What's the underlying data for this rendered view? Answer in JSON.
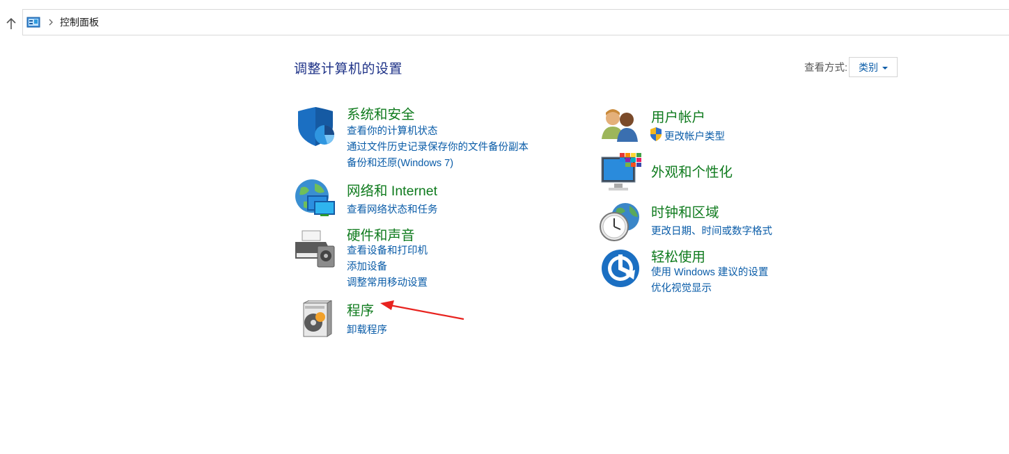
{
  "breadcrumb": {
    "current": "控制面板"
  },
  "main": {
    "heading": "调整计算机的设置",
    "view_by": {
      "label": "查看方式:",
      "value": "类别"
    }
  },
  "categories": {
    "system_security": {
      "title": "系统和安全",
      "links": [
        "查看你的计算机状态",
        "通过文件历史记录保存你的文件备份副本",
        "备份和还原(Windows 7)"
      ]
    },
    "network": {
      "title": "网络和 Internet",
      "links": [
        "查看网络状态和任务"
      ]
    },
    "hardware": {
      "title": "硬件和声音",
      "links": [
        "查看设备和打印机",
        "添加设备",
        "调整常用移动设置"
      ]
    },
    "programs": {
      "title": "程序",
      "links": [
        "卸载程序"
      ]
    },
    "user_accounts": {
      "title": "用户帐户",
      "links": [
        "更改帐户类型"
      ]
    },
    "appearance": {
      "title": "外观和个性化",
      "links": []
    },
    "clock_region": {
      "title": "时钟和区域",
      "links": [
        "更改日期、时间或数字格式"
      ]
    },
    "ease_of_access": {
      "title": "轻松使用",
      "links": [
        "使用 Windows 建议的设置",
        "优化视觉显示"
      ]
    }
  },
  "colors": {
    "title_green": "#0f7b1e",
    "link_blue": "#0a5ca8",
    "heading_navy": "#1e3287",
    "annotation_red": "#e8231f"
  },
  "icons": [
    "up-arrow-icon",
    "control-panel-icon",
    "chevron-right-icon",
    "shield-icon",
    "network-globe-icon",
    "printer-icon",
    "programs-disc-icon",
    "users-icon",
    "uac-shield-icon",
    "display-color-icon",
    "clock-globe-icon",
    "ease-access-icon"
  ]
}
